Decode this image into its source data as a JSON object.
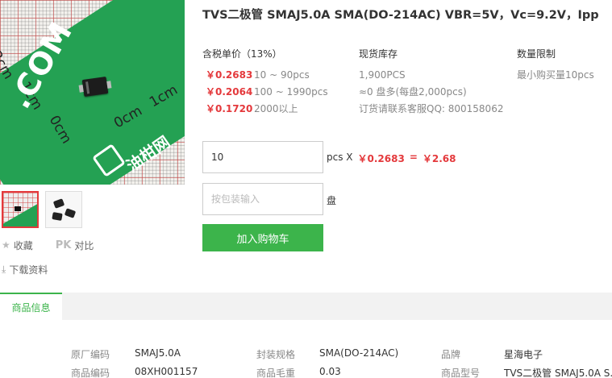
{
  "product": {
    "title": "TVS二极管 SMAJ5.0A SMA(DO-214AC) VBR=5V，Vc=9.2V，Ipp",
    "image": {
      "ruler_labels": [
        "2cm",
        "1cm",
        "0cm",
        "0cm",
        "1cm"
      ],
      "brand_text": ".COM",
      "logo_text": "油柑网"
    }
  },
  "pricing": {
    "header": "含税单价（13%）",
    "tiers": [
      {
        "price": "￥0.2683",
        "range": "10 ~ 90pcs"
      },
      {
        "price": "￥0.2064",
        "range": "100 ~ 1990pcs"
      },
      {
        "price": "￥0.1720",
        "range": "2000以上"
      }
    ]
  },
  "stock": {
    "header": "现货库存",
    "lines": [
      "1,900PCS",
      "≈0 盘多(每盘2,000pcs)",
      "订货请联系客服QQ: 800158062"
    ]
  },
  "limit": {
    "header": "数量限制",
    "text": "最小购买量10pcs"
  },
  "order": {
    "qty_value": "10",
    "qty_unit": "pcs X",
    "unit_price": "￥0.2683",
    "equals": "=",
    "total": "￥2.68",
    "pack_placeholder": "按包装输入",
    "pack_unit": "盘",
    "cart_button": "加入购物车"
  },
  "side_actions": {
    "favorite": "收藏",
    "pk": "PK",
    "compare": "对比",
    "download": "下载资料"
  },
  "tabs": {
    "active": "商品信息"
  },
  "specs": [
    {
      "label": "原厂编码",
      "value": "SMAJ5.0A"
    },
    {
      "label": "封装规格",
      "value": "SMA(DO-214AC)"
    },
    {
      "label": "品牌",
      "value": "星海电子"
    },
    {
      "label": "商品编码",
      "value": "08XH001157"
    },
    {
      "label": "商品毛重",
      "value": "0.03"
    },
    {
      "label": "商品型号",
      "value": "TVS二极管 SMAJ5.0A S..."
    }
  ],
  "colors": {
    "accent_green": "#3cb44b",
    "price_red": "#e4393c"
  }
}
